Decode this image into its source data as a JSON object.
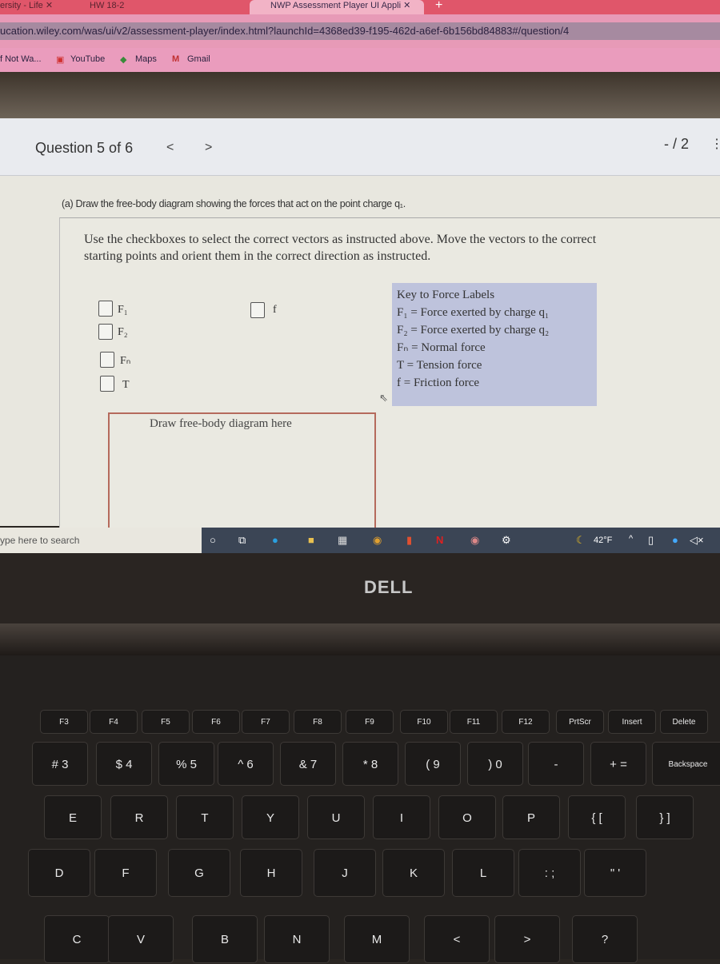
{
  "browser": {
    "tabs": [
      {
        "label": "ersity - Life"
      },
      {
        "label": "HW 18-2"
      },
      {
        "label": "NWP Assessment Player UI Appli"
      }
    ],
    "url": "ucation.wiley.com/was/ui/v2/assessment-player/index.html?launchId=4368ed39-f195-462d-a6ef-6b156bd84883#/question/4",
    "bookmarks": [
      {
        "label": "f Not Wa..."
      },
      {
        "label": "YouTube"
      },
      {
        "label": "Maps"
      },
      {
        "label": "Gmail"
      }
    ],
    "accent": "#e0566a"
  },
  "header": {
    "question": "Question 5 of 6",
    "prev": "<",
    "next": ">",
    "score": "- / 2"
  },
  "question": {
    "prompt": "(a) Draw the free-body diagram showing the forces that act on the point charge q₁.",
    "instructions": "Use the checkboxes to select the correct vectors as instructed above. Move the vectors to the correct starting points and orient them in the correct direction as instructed.",
    "checkboxes": [
      {
        "label": "F₁",
        "checked": false
      },
      {
        "label": "F₂",
        "checked": false
      },
      {
        "label": "Fₙ",
        "checked": false
      },
      {
        "label": "T",
        "checked": false
      },
      {
        "label": "f",
        "checked": false
      }
    ],
    "key": {
      "title": "Key to Force Labels",
      "lines": [
        "F₁ = Force exerted by charge q₁",
        "F₂ = Force exerted by charge q₂",
        "Fₙ = Normal force",
        "T = Tension force",
        "f = Friction force"
      ]
    },
    "draw_label": "Draw free-body diagram here"
  },
  "taskbar": {
    "search": "ype here to search",
    "weather": "42°F"
  },
  "laptop": {
    "brand": "DELL"
  },
  "keyboard": {
    "fn": [
      "F3",
      "F4",
      "F5",
      "F6",
      "F7",
      "F8",
      "F9",
      "F10",
      "F11",
      "F12",
      "PrtScr",
      "Insert",
      "Delete"
    ],
    "num": [
      "# 3",
      "$ 4",
      "% 5",
      "^ 6",
      "& 7",
      "* 8",
      "( 9",
      ") 0",
      "-",
      "+ =",
      "Backspace"
    ],
    "row1": [
      "E",
      "R",
      "T",
      "Y",
      "U",
      "I",
      "O",
      "P",
      "{ [",
      "} ]"
    ],
    "row2": [
      "D",
      "F",
      "G",
      "H",
      "J",
      "K",
      "L",
      ": ;",
      "\" '"
    ],
    "row3": [
      "C",
      "V",
      "B",
      "N",
      "M",
      "<",
      ">",
      "?"
    ]
  }
}
